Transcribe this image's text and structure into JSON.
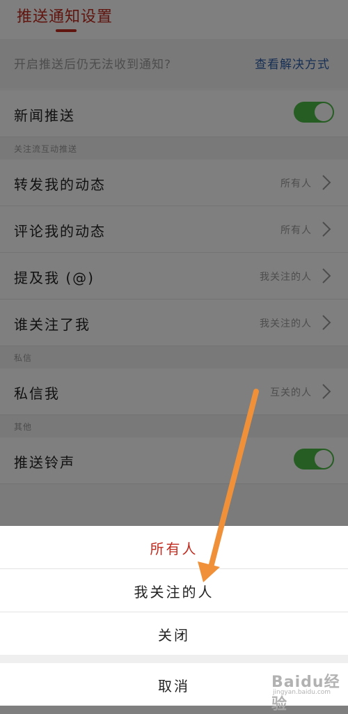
{
  "header": {
    "title": "推送通知设置"
  },
  "tip": {
    "text": "开启推送后仍无法收到通知?",
    "link": "查看解决方式"
  },
  "news_push": {
    "label": "新闻推送"
  },
  "section_follow": {
    "label": "关注流互动推送"
  },
  "rows": {
    "forward": {
      "label": "转发我的动态",
      "value": "所有人"
    },
    "comment": {
      "label": "评论我的动态",
      "value": "所有人"
    },
    "mention": {
      "label": "提及我 (@)",
      "value": "我关注的人"
    },
    "follow": {
      "label": "谁关注了我",
      "value": "我关注的人"
    },
    "dm": {
      "label": "私信我",
      "value": "互关的人"
    },
    "ringtone": {
      "label": "推送铃声"
    }
  },
  "section_dm": {
    "label": "私信"
  },
  "section_other": {
    "label": "其他"
  },
  "sheet": {
    "options": [
      "所有人",
      "我关注的人",
      "关闭"
    ],
    "cancel": "取消"
  },
  "watermark": {
    "text": "Baidu经验",
    "sub": "jingyan.baidu.com"
  },
  "colors": {
    "accent": "#c02b1f",
    "toggle_on": "#4cbb45",
    "link": "#2e5fa8",
    "annotation_arrow": "#f0913a"
  },
  "icons": {
    "chevron": "chevron-right-icon",
    "toggle": "toggle-switch"
  }
}
